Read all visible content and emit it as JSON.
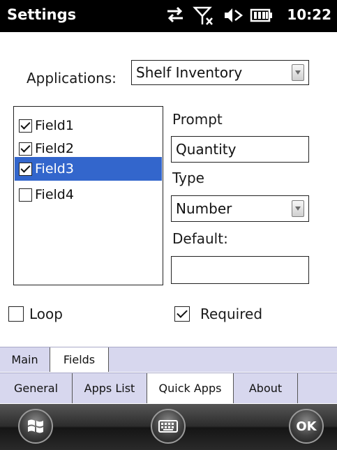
{
  "status_bar": {
    "title": "Settings",
    "time": "10:22",
    "icons": [
      "sync-arrows-icon",
      "no-signal-icon",
      "volume-muted-icon",
      "battery-icon"
    ]
  },
  "applications": {
    "label": "Applications:",
    "selected": "Shelf Inventory"
  },
  "fields": {
    "items": [
      {
        "label": "Field1",
        "checked": true,
        "selected": false
      },
      {
        "label": "Field2",
        "checked": true,
        "selected": false
      },
      {
        "label": "Field3",
        "checked": true,
        "selected": true
      },
      {
        "label": "Field4",
        "checked": false,
        "selected": false
      }
    ]
  },
  "form": {
    "prompt_label": "Prompt",
    "prompt_value": "Quantity",
    "type_label": "Type",
    "type_value": "Number",
    "default_label": "Default:",
    "default_value": ""
  },
  "options": {
    "loop_label": "Loop",
    "loop_checked": false,
    "required_label": "Required",
    "required_checked": true
  },
  "tabs_top": [
    {
      "label": "Main",
      "active": false
    },
    {
      "label": "Fields",
      "active": true
    }
  ],
  "tabs_bottom": [
    {
      "label": "General",
      "active": false
    },
    {
      "label": "Apps List",
      "active": false
    },
    {
      "label": "Quick Apps",
      "active": true
    },
    {
      "label": "About",
      "active": false
    }
  ],
  "softkeys": {
    "start_icon": "windows-start-icon",
    "keyboard_icon": "keyboard-icon",
    "ok_label": "OK"
  },
  "colors": {
    "selection": "#3366cc",
    "tab_bar": "#d7d7ee",
    "status_bar": "#000000"
  }
}
